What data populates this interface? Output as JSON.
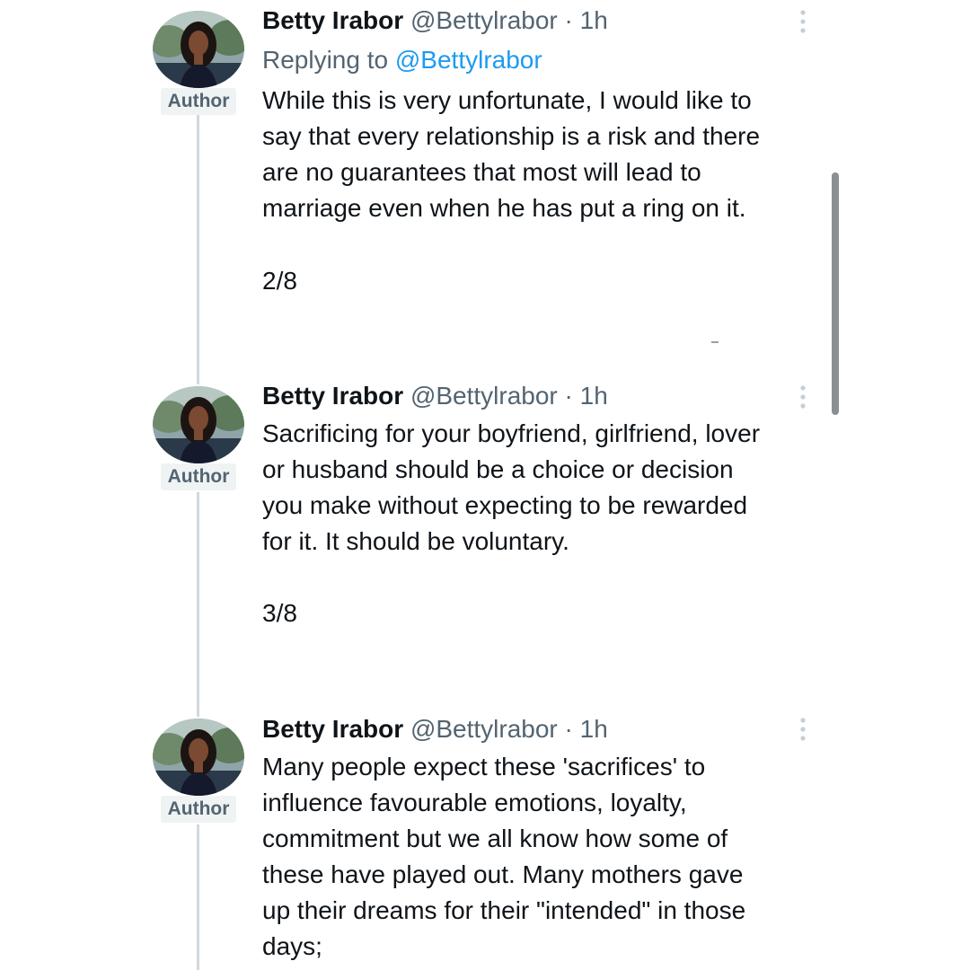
{
  "tweets": [
    {
      "name": "Betty Irabor",
      "handle": "@Bettylrabor",
      "time": "· 1h",
      "badge": "Author",
      "replying_prefix": "Replying to",
      "replying_mention": "@Bettylrabor",
      "lines": [
        "While this is very unfortunate, I would like to",
        "say that every relationship is a risk and there",
        "are no guarantees that most will lead to",
        "marriage even when he has put a ring on it."
      ],
      "counter": "2/8"
    },
    {
      "name": "Betty Irabor",
      "handle": "@Bettylrabor",
      "time": "· 1h",
      "badge": "Author",
      "lines": [
        "Sacrificing for your boyfriend, girlfriend, lover",
        "or husband should be a choice or decision",
        "you make without expecting to be rewarded",
        "for it. It should be voluntary."
      ],
      "counter": "3/8"
    },
    {
      "name": "Betty Irabor",
      "handle": "@Bettylrabor",
      "time": "· 1h",
      "badge": "Author",
      "lines": [
        "Many people expect  these 'sacrifices' to",
        "influence favourable emotions, loyalty,",
        "commitment but we all know how some of",
        "these have played out.  Many mothers gave",
        "up their dreams for their \"intended\" in those",
        "days;"
      ]
    }
  ],
  "icons": {
    "more": "more-vertical-icon",
    "avatar": "avatar"
  },
  "colors": {
    "text": "#0f1419",
    "secondary": "#536471",
    "link": "#1d9bf0",
    "thread_line": "#cfd9de",
    "badge_bg": "#eff3f4"
  }
}
